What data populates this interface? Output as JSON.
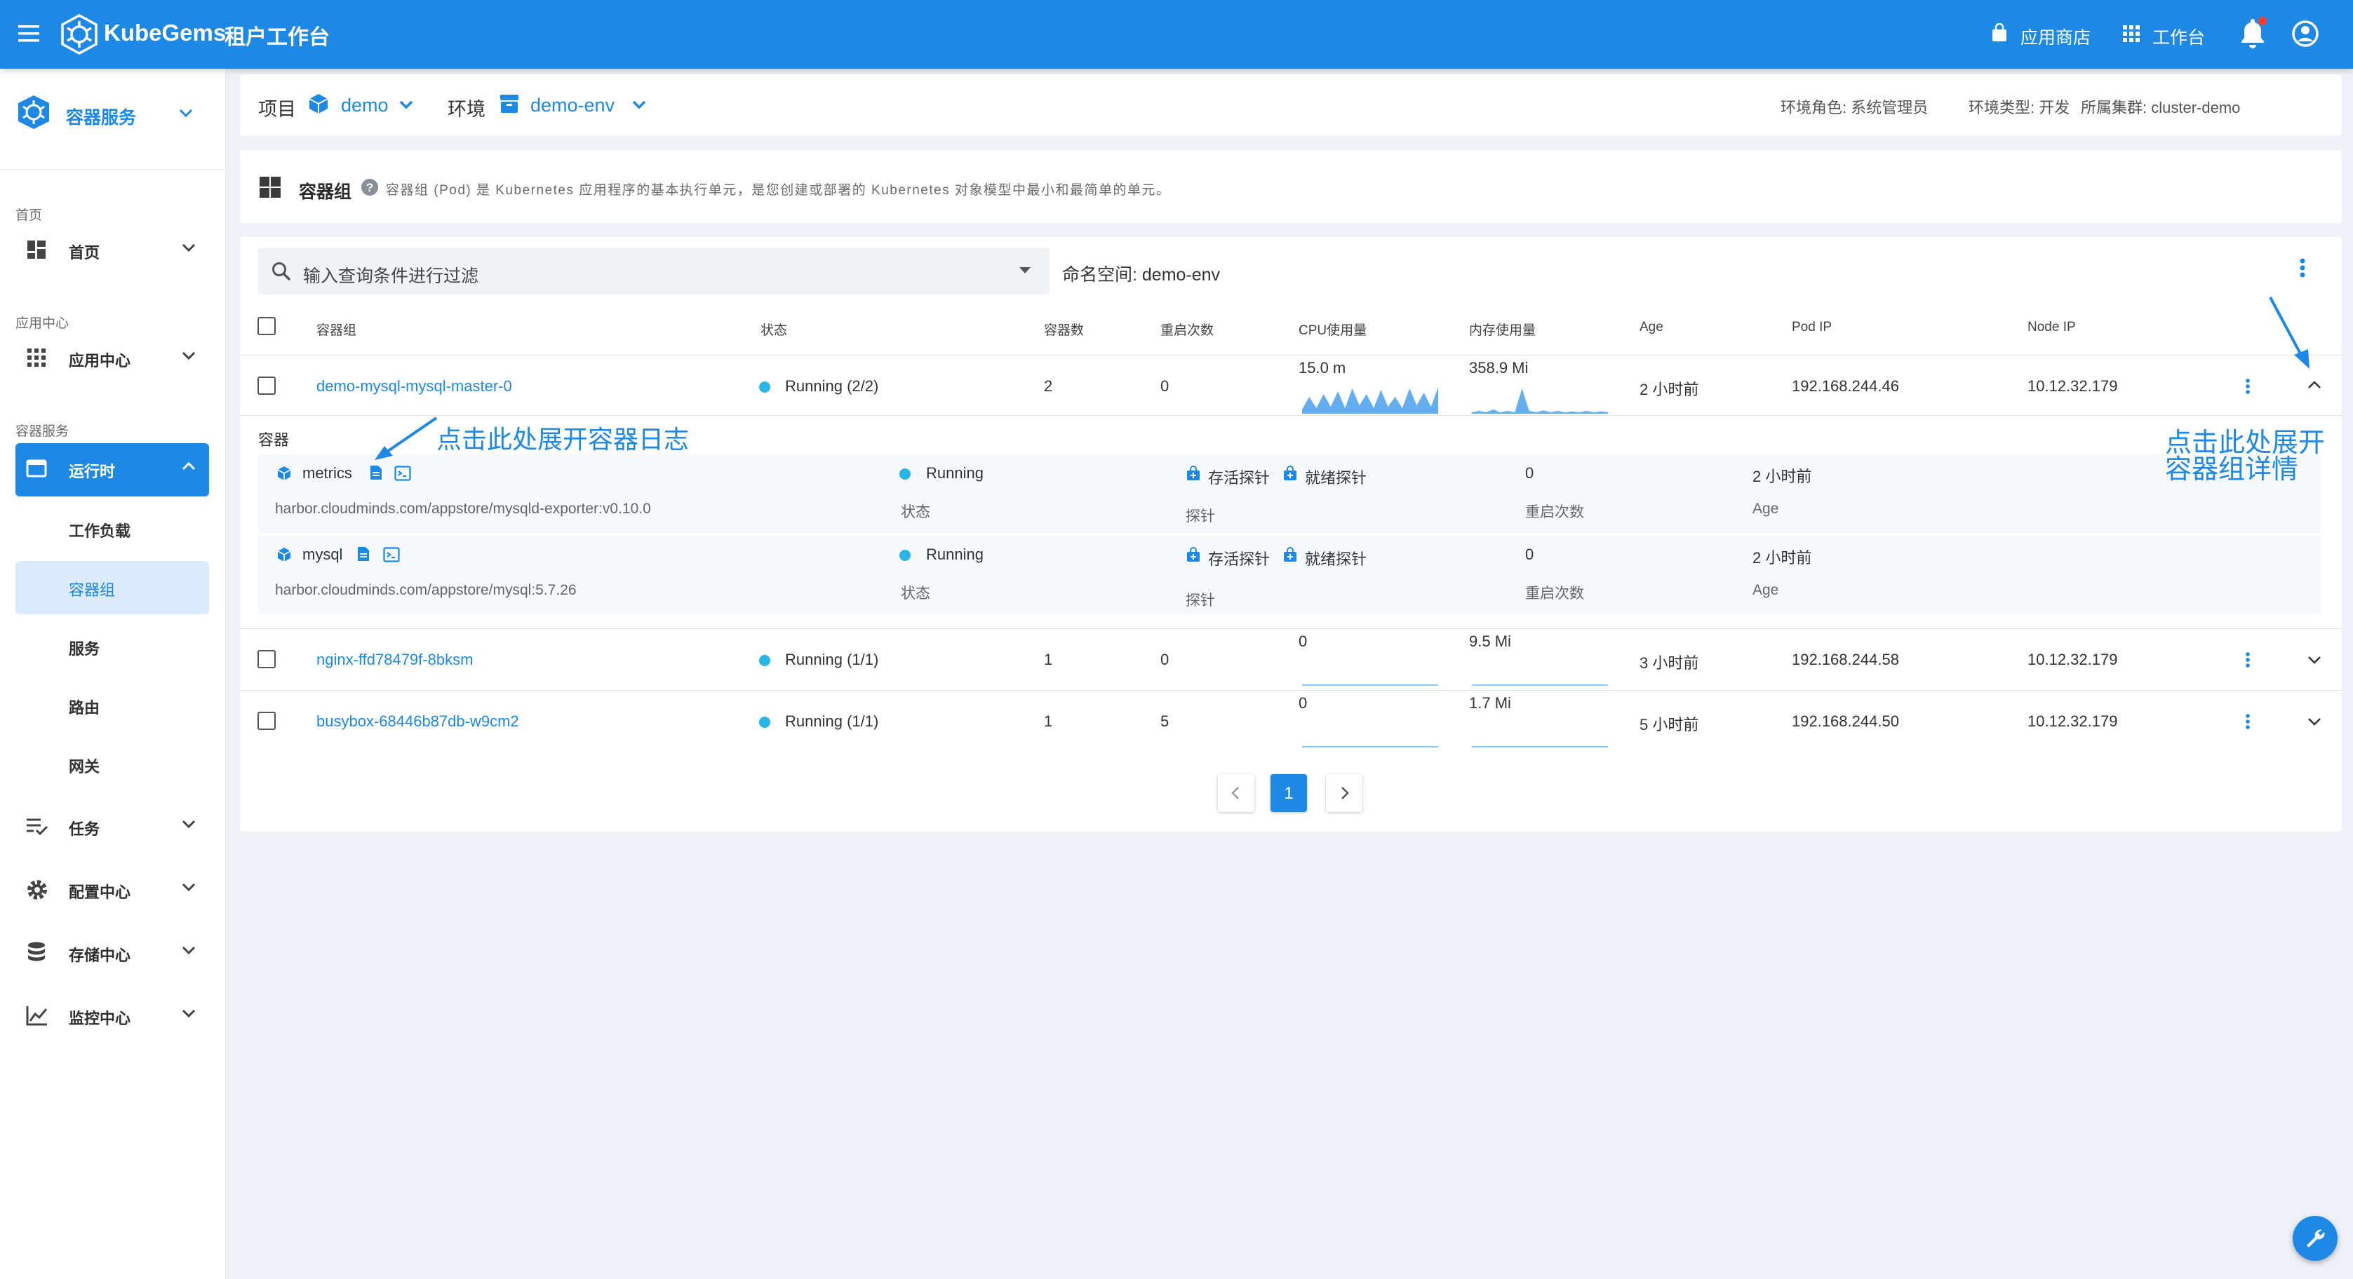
{
  "colors": {
    "primary": "#1e88e5",
    "running": "#29b6e6",
    "page_bg": "#eef2f7"
  },
  "topbar": {
    "brand": "KubeGems",
    "title": "租户工作台",
    "app_store": "应用商店",
    "workspace": "工作台",
    "icons": [
      "menu-icon",
      "kubegems-logo-icon",
      "store-icon",
      "apps-grid-icon",
      "bell-icon",
      "account-icon"
    ]
  },
  "sidebar": {
    "module": "容器服务",
    "sections": {
      "home": "首页",
      "app_center": "应用中心",
      "container_service": "容器服务"
    },
    "items": {
      "home": "首页",
      "app_center": "应用中心",
      "runtime": "运行时",
      "workload": "工作负载",
      "pods": "容器组",
      "services": "服务",
      "routes": "路由",
      "gateway": "网关",
      "tasks": "任务",
      "config": "配置中心",
      "storage": "存储中心",
      "monitor": "监控中心"
    }
  },
  "context_bar": {
    "project_label": "项目",
    "project": "demo",
    "env_label": "环境",
    "env": "demo-env",
    "env_role": "环境角色: 系统管理员",
    "env_type": "环境类型: 开发",
    "cluster": "所属集群: cluster-demo"
  },
  "page_header": {
    "title": "容器组",
    "description": "容器组 (Pod) 是 Kubernetes 应用程序的基本执行单元，是您创建或部署的 Kubernetes 对象模型中最小和最简单的单元。"
  },
  "filter": {
    "placeholder": "输入查询条件进行过滤",
    "namespace": "命名空间: demo-env"
  },
  "table": {
    "columns": [
      "容器组",
      "状态",
      "容器数",
      "重启次数",
      "CPU使用量",
      "内存使用量",
      "Age",
      "Pod IP",
      "Node IP"
    ],
    "rows": [
      {
        "name": "demo-mysql-mysql-master-0",
        "status": "Running (2/2)",
        "containers": "2",
        "restarts": "0",
        "cpu": "15.0 m",
        "memory": "358.9 Mi",
        "age": "2 小时前",
        "pod_ip": "192.168.244.46",
        "node_ip": "10.12.32.179",
        "expanded": true
      },
      {
        "name": "nginx-ffd78479f-8bksm",
        "status": "Running (1/1)",
        "containers": "1",
        "restarts": "0",
        "cpu": "0",
        "memory": "9.5 Mi",
        "age": "3 小时前",
        "pod_ip": "192.168.244.58",
        "node_ip": "10.12.32.179",
        "expanded": false
      },
      {
        "name": "busybox-68446b87db-w9cm2",
        "status": "Running (1/1)",
        "containers": "1",
        "restarts": "5",
        "cpu": "0",
        "memory": "1.7 Mi",
        "age": "5 小时前",
        "pod_ip": "192.168.244.50",
        "node_ip": "10.12.32.179",
        "expanded": false
      }
    ],
    "sparklines": {
      "row0_cpu": [
        0.15,
        0.6,
        0.2,
        0.7,
        0.25,
        0.8,
        0.2,
        0.9,
        0.3,
        0.7,
        0.2,
        0.85,
        0.25,
        0.6,
        0.2,
        0.9,
        0.3,
        0.75,
        0.25,
        0.95
      ],
      "row0_mem": [
        0.05,
        0.1,
        0.05,
        0.15,
        0.05,
        0.1,
        0.05,
        0.9,
        0.1,
        0.05,
        0.12,
        0.05,
        0.1,
        0.05,
        0.08,
        0.05,
        0.1,
        0.05,
        0.08,
        0.05
      ]
    }
  },
  "containers_panel": {
    "title": "容器",
    "containers": [
      {
        "name": "metrics",
        "image": "harbor.cloudminds.com/appstore/mysqld-exporter:v0.10.0",
        "status": "Running",
        "liveness": "存活探针",
        "readiness": "就绪探针",
        "restarts": "0",
        "age": "2 小时前"
      },
      {
        "name": "mysql",
        "image": "harbor.cloudminds.com/appstore/mysql:5.7.26",
        "status": "Running",
        "liveness": "存活探针",
        "readiness": "就绪探针",
        "restarts": "0",
        "age": "2 小时前"
      }
    ],
    "labels": {
      "status": "状态",
      "probe": "探针",
      "restarts": "重启次数",
      "age": "Age"
    }
  },
  "annotations": {
    "log": "点击此处展开容器日志",
    "detail_line1": "点击此处展开",
    "detail_line2": "容器组详情"
  },
  "pagination": {
    "current": "1"
  }
}
